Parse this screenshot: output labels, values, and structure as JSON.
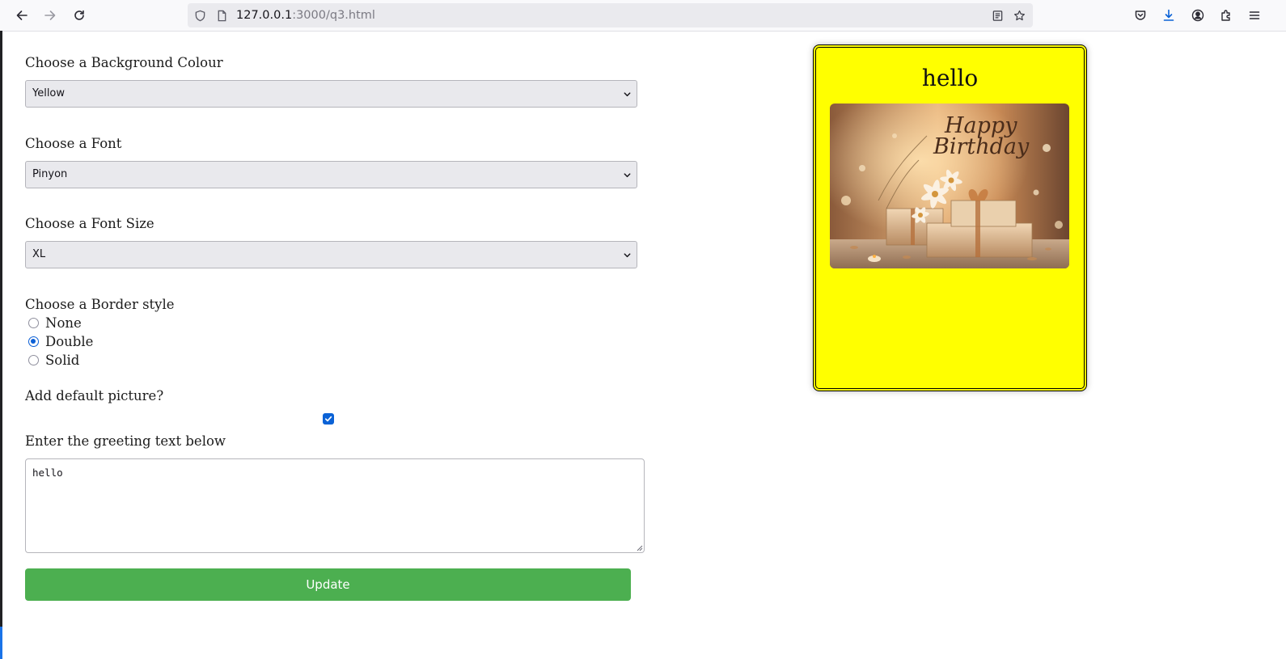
{
  "browser": {
    "url_host": "127.0.0.1",
    "url_rest": ":3000/q3.html"
  },
  "form": {
    "background_label": "Choose a Background Colour",
    "background_value": "Yellow",
    "font_label": "Choose a Font",
    "font_value": "Pinyon",
    "font_size_label": "Choose a Font Size",
    "font_size_value": "XL",
    "border_label": "Choose a Border style",
    "border_options": [
      {
        "label": "None",
        "checked": false
      },
      {
        "label": "Double",
        "checked": true
      },
      {
        "label": "Solid",
        "checked": false
      }
    ],
    "picture_label": "Add default picture?",
    "picture_checked": true,
    "greeting_label": "Enter the greeting text below",
    "greeting_value": "hello",
    "update_label": "Update"
  },
  "card": {
    "text": "hello",
    "background": "#ffff00",
    "border_style": "double",
    "picture_caption_line1": "Happy",
    "picture_caption_line2": "Birthday"
  },
  "colors": {
    "accent_blue": "#0b62d6",
    "update_green": "#4caf50"
  }
}
